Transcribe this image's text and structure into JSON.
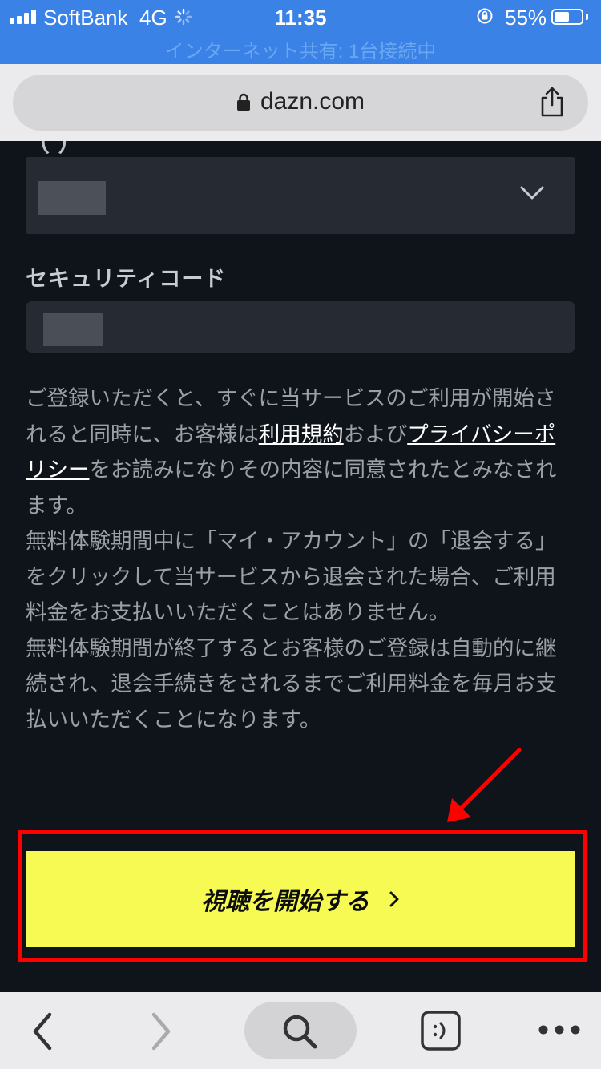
{
  "status_bar": {
    "carrier": "SoftBank",
    "network": "4G",
    "time": "11:35",
    "battery_percent": "55%",
    "battery_level": 0.55,
    "hotspot_text": "インターネット共有: 1台接続中"
  },
  "browser": {
    "url": "dazn.com"
  },
  "form": {
    "security_code_label": "セキュリティコード"
  },
  "legal": {
    "line1_before": "ご登録いただくと、すぐに当サービスのご利用が開始されると同時に、お客様は",
    "terms_link": "利用規約",
    "and": "および",
    "privacy_link": "プライバシーポリシー",
    "line1_after": "をお読みになりその内容に同意されたとみなされます。",
    "paragraph2": "無料体験期間中に「マイ・アカウント」の「退会する」をクリックして当サービスから退会された場合、ご利用料金をお支払いいただくことはありません。",
    "paragraph3": "無料体験期間が終了するとお客様のご登録は自動的に継続され、退会手続きをされるまでご利用料金を毎月お支払いいただくことになります。"
  },
  "cta": {
    "label": "視聴を開始する"
  },
  "colors": {
    "status_bar_bg": "#3b82e6",
    "page_bg": "#0f141b",
    "field_bg": "#262b33",
    "cta_bg": "#f6fa52",
    "annotation_red": "#ff0000"
  }
}
